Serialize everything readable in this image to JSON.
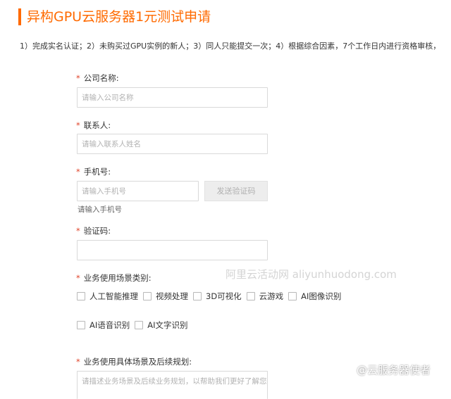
{
  "page": {
    "title": "异构GPU云服务器1元测试申请",
    "notice": "1）完成实名认证；2）未购买过GPU实例的新人；3）同人只能提交一次；4）根据综合因素，7个工作日内进行资格审核，"
  },
  "form": {
    "company": {
      "label": "公司名称:",
      "placeholder": "请输入公司名称"
    },
    "contact": {
      "label": "联系人:",
      "placeholder": "请输入联系人姓名"
    },
    "phone": {
      "label": "手机号:",
      "placeholder": "请输入手机号",
      "hint": "请输入手机号",
      "send_code_label": "发送验证码"
    },
    "code": {
      "label": "验证码:",
      "placeholder": ""
    },
    "scene_category": {
      "label": "业务使用场景类别:",
      "options_row1": [
        "人工智能推理",
        "视频处理",
        "3D可视化",
        "云游戏",
        "AI图像识别"
      ],
      "options_row2": [
        "AI语音识别",
        "AI文字识别"
      ]
    },
    "scene_detail": {
      "label": "业务使用具体场景及后续规划:",
      "placeholder": "请描述业务场景及后续业务规划，以帮助我们更好了解您的"
    },
    "required_mark": "*"
  },
  "watermark": "阿里云活动网  aliyunhuodong.com",
  "corner_mark": "@云服务器使者",
  "colors": {
    "accent": "#ff6a00",
    "required": "#e0442a",
    "border": "#d9d9d9"
  }
}
